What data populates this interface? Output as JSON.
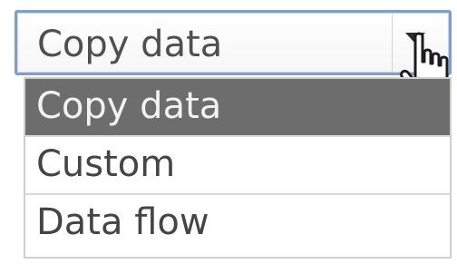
{
  "select": {
    "value": "Copy data",
    "options": [
      {
        "label": "Copy data",
        "selected": true
      },
      {
        "label": "Custom",
        "selected": false
      },
      {
        "label": "Data flow",
        "selected": false
      }
    ]
  },
  "icons": {
    "dropdown": "chevron-down-icon",
    "cursor": "hand-pointer-icon"
  },
  "colors": {
    "selected_option_bg": "#6d6d6d",
    "select_border": "#7f9fcb"
  }
}
